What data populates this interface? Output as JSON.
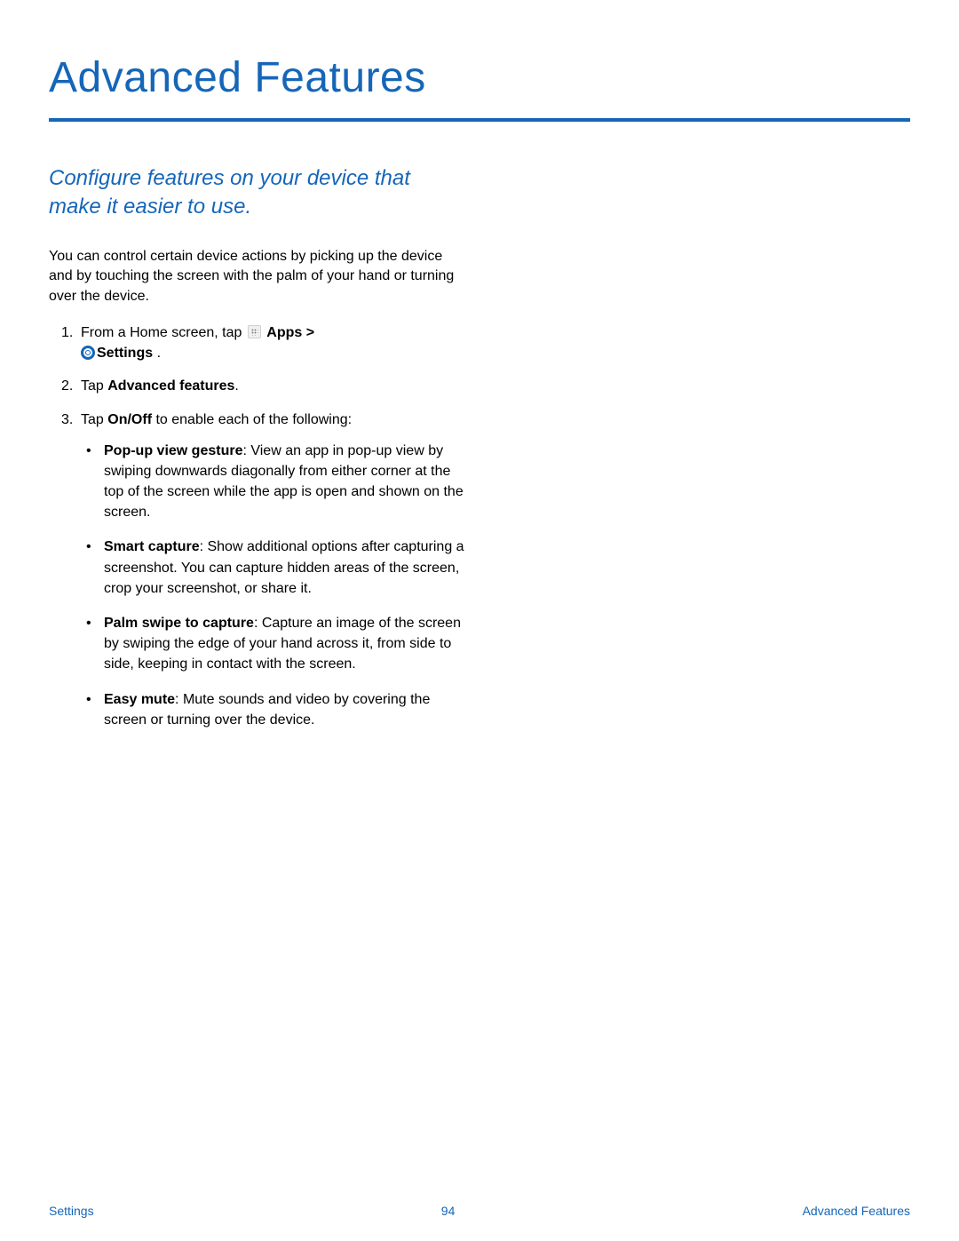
{
  "title": "Advanced Features",
  "subtitle": "Configure features on your device that make it easier to use.",
  "intro": "You can control certain device actions by picking up the device and by touching the screen with the palm of your hand or turning over the device.",
  "steps": {
    "s1_pre": "From a Home screen, tap ",
    "s1_apps": "Apps",
    "s1_gt": " > ",
    "s1_settings": "Settings",
    "s1_end": " .",
    "s2_pre": "Tap ",
    "s2_bold": "Advanced features",
    "s2_end": ".",
    "s3_pre": "Tap ",
    "s3_bold": "On/Off",
    "s3_end": " to enable each of the following:"
  },
  "bullets": [
    {
      "label": "Pop-up view gesture",
      "text": ": View an app in pop-up view by swiping downwards diagonally from either corner at the top of the screen while the app is open and shown on the screen."
    },
    {
      "label": "Smart capture",
      "text": ": Show additional options after capturing a screenshot. You can capture hidden areas of the screen, crop your screenshot, or share it."
    },
    {
      "label": "Palm swipe to capture",
      "text": ": Capture an image of the screen by swiping the edge of your hand across it, from side to side, keeping in contact with the screen."
    },
    {
      "label": "Easy mute",
      "text": ": Mute sounds and video by covering the screen or turning over the device."
    }
  ],
  "footer": {
    "left": "Settings",
    "center": "94",
    "right": "Advanced Features"
  }
}
